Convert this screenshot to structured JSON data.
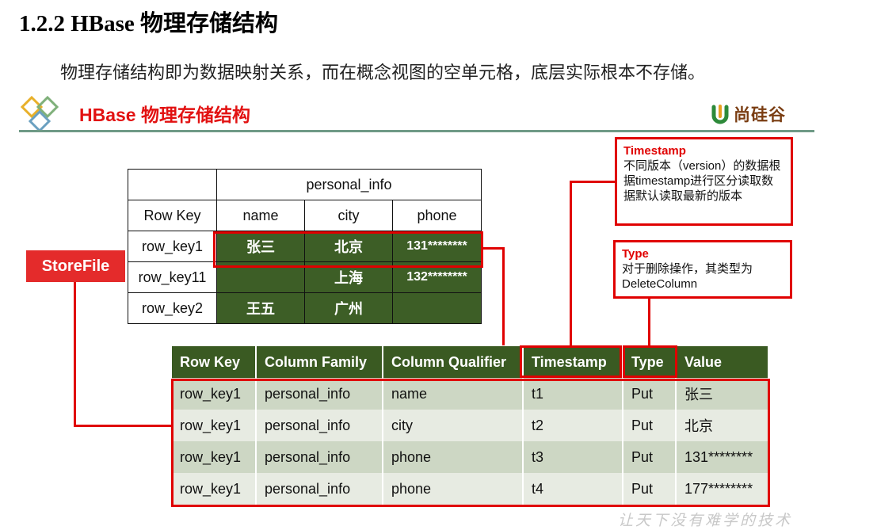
{
  "heading": "1.2.2 HBase 物理存储结构",
  "subtitle": "物理存储结构即为数据映射关系，而在概念视图的空单元格，底层实际根本不存储。",
  "slide": {
    "title": "HBase 物理存储结构",
    "brand": "尚硅谷",
    "footer": "让天下没有难学的技术"
  },
  "top_table": {
    "family": "personal_info",
    "headers": [
      "Row Key",
      "name",
      "city",
      "phone"
    ],
    "rows": [
      [
        "row_key1",
        "张三",
        "北京",
        "131********"
      ],
      [
        "row_key11",
        "",
        "上海",
        "132********"
      ],
      [
        "row_key2",
        "王五",
        "广州",
        ""
      ]
    ]
  },
  "bottom_table": {
    "headers": [
      "Row Key",
      "Column Family",
      "Column Qualifier",
      "Timestamp",
      "Type",
      "Value"
    ],
    "rows": [
      [
        "row_key1",
        "personal_info",
        "name",
        "t1",
        "Put",
        "张三"
      ],
      [
        "row_key1",
        "personal_info",
        "city",
        "t2",
        "Put",
        "北京"
      ],
      [
        "row_key1",
        "personal_info",
        "phone",
        "t3",
        "Put",
        "131********"
      ],
      [
        "row_key1",
        "personal_info",
        "phone",
        "t4",
        "Put",
        "177********"
      ]
    ]
  },
  "callouts": {
    "timestamp": {
      "title": "Timestamp",
      "body": "不同版本（version）的数据根据timestamp进行区分读取数据默认读取最新的版本"
    },
    "type": {
      "title": "Type",
      "body": "对于删除操作，其类型为DeleteColumn"
    },
    "storefile": "StoreFile"
  },
  "colors": {
    "accent_red": "#e00000",
    "header_green": "#3a5a22",
    "cell_green": "#3d5e26",
    "row_light": "#e7ebe2",
    "row_dark": "#cdd7c4"
  }
}
